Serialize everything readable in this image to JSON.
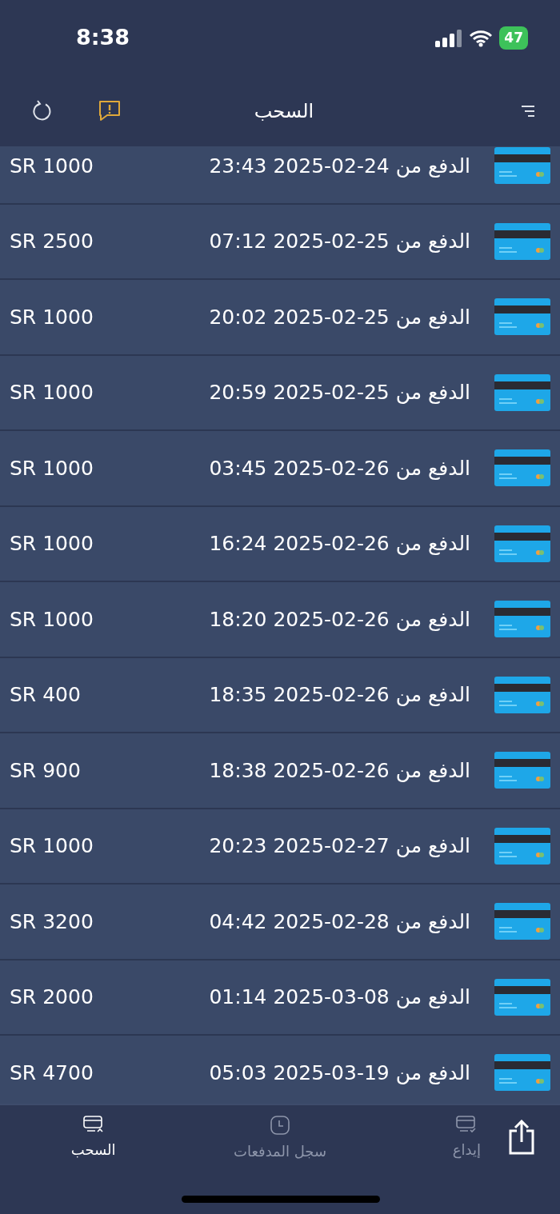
{
  "status_bar": {
    "time": "8:38",
    "battery": "47"
  },
  "header": {
    "title": "السحب"
  },
  "transactions": [
    {
      "label": "الدفع من 24-02-2025 23:43",
      "amount": "SR 1000"
    },
    {
      "label": "الدفع من 25-02-2025 07:12",
      "amount": "SR 2500"
    },
    {
      "label": "الدفع من 25-02-2025 20:02",
      "amount": "SR 1000"
    },
    {
      "label": "الدفع من 25-02-2025 20:59",
      "amount": "SR 1000"
    },
    {
      "label": "الدفع من 26-02-2025 03:45",
      "amount": "SR 1000"
    },
    {
      "label": "الدفع من 26-02-2025 16:24",
      "amount": "SR 1000"
    },
    {
      "label": "الدفع من 26-02-2025 18:20",
      "amount": "SR 1000"
    },
    {
      "label": "الدفع من 26-02-2025 18:35",
      "amount": "SR 400"
    },
    {
      "label": "الدفع من 26-02-2025 18:38",
      "amount": "SR 900"
    },
    {
      "label": "الدفع من 27-02-2025 20:23",
      "amount": "SR 1000"
    },
    {
      "label": "الدفع من 28-02-2025 04:42",
      "amount": "SR 3200"
    },
    {
      "label": "الدفع من 08-03-2025 01:14",
      "amount": "SR 2000"
    },
    {
      "label": "الدفع من 19-03-2025 05:03",
      "amount": "SR 4700"
    }
  ],
  "tabs": [
    {
      "label": "إيداع",
      "kind": "deposit",
      "selected": false
    },
    {
      "label": "سجل المدفعات",
      "kind": "history",
      "selected": false
    },
    {
      "label": "السحب",
      "kind": "withdraw",
      "selected": true
    }
  ]
}
